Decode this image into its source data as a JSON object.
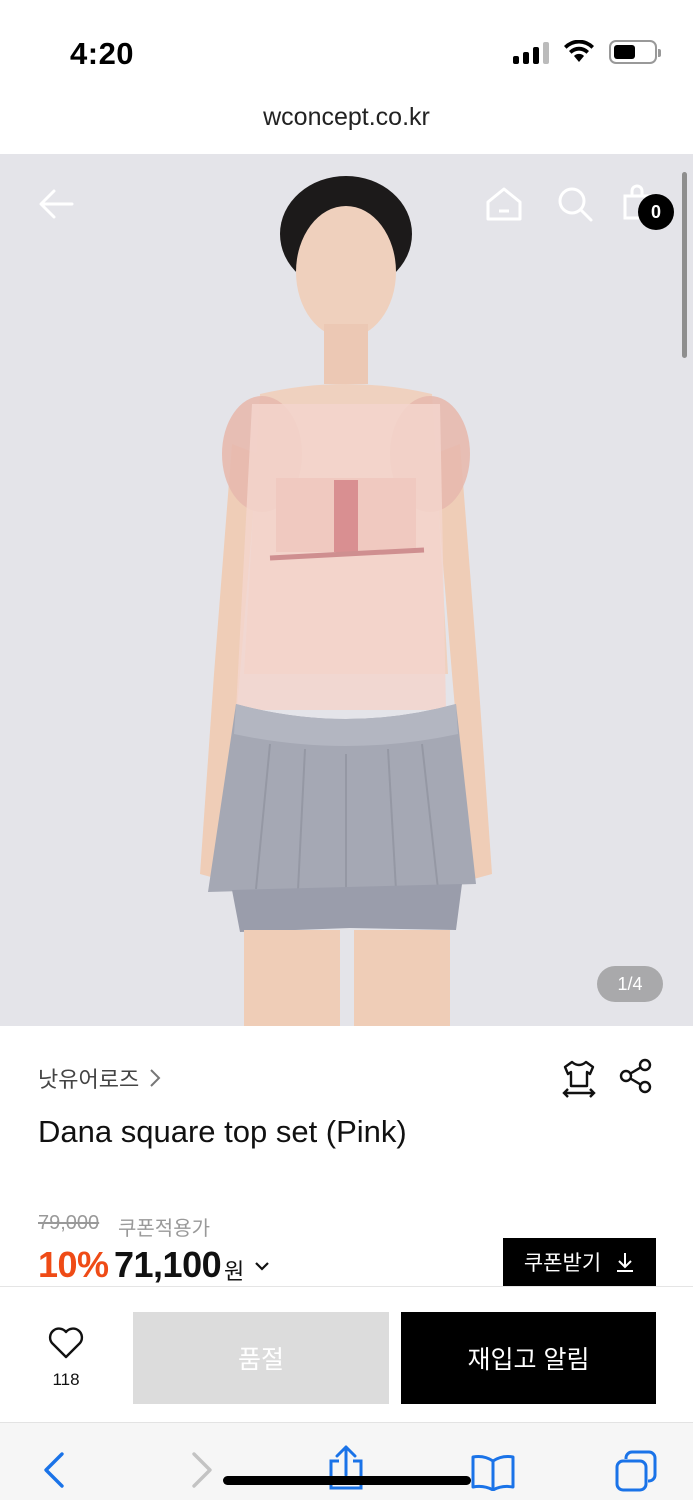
{
  "status_bar": {
    "time": "4:20",
    "battery_percent": 55
  },
  "browser": {
    "url": "wconcept.co.kr"
  },
  "hero": {
    "pager": "1/4",
    "cart_count": "0",
    "icons": [
      "back-arrow-icon",
      "home-icon",
      "search-icon",
      "shopping-bag-icon"
    ]
  },
  "product": {
    "brand": "낫유어로즈",
    "title": "Dana square top set (Pink)",
    "original_price": "79,000",
    "coupon_price_label": "쿠폰적용가",
    "discount": "10%",
    "price": "71,100",
    "currency": "원",
    "coupon_button": "쿠폰받기"
  },
  "purchase": {
    "like_count": "118",
    "soldout_label": "품절",
    "restock_label": "재입고 알림"
  },
  "colors": {
    "discount": "#ef4b16",
    "dark": "#000000",
    "soldout": "#dcdcdc"
  }
}
